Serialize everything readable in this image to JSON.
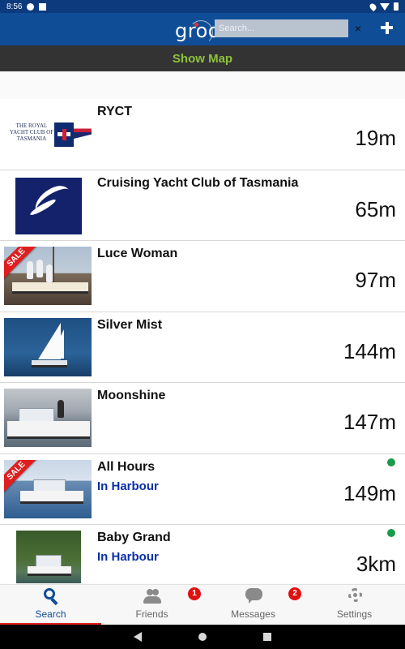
{
  "status_bar": {
    "time": "8:56"
  },
  "app_bar": {
    "logo_text": "groo",
    "search_placeholder": "Search...",
    "clear_label": "×"
  },
  "show_map_label": "Show Map",
  "listings": [
    {
      "title": "RYCT",
      "distance": "19m",
      "status": "",
      "online": false,
      "sale": false,
      "logo_text": "THE ROYAL YACHT CLUB OF TASMANIA"
    },
    {
      "title": "Cruising Yacht Club of Tasmania",
      "distance": "65m",
      "status": "",
      "online": false,
      "sale": false
    },
    {
      "title": "Luce Woman",
      "distance": "97m",
      "status": "",
      "online": false,
      "sale": true
    },
    {
      "title": "Silver Mist",
      "distance": "144m",
      "status": "",
      "online": false,
      "sale": false
    },
    {
      "title": "Moonshine",
      "distance": "147m",
      "status": "",
      "online": false,
      "sale": false
    },
    {
      "title": "All Hours",
      "distance": "149m",
      "status": "In Harbour",
      "online": true,
      "sale": true
    },
    {
      "title": "Baby Grand",
      "distance": "3km",
      "status": "In Harbour",
      "online": true,
      "sale": false
    }
  ],
  "sale_badge": "SALE",
  "tabs": [
    {
      "label": "Search",
      "badge": ""
    },
    {
      "label": "Friends",
      "badge": "1"
    },
    {
      "label": "Messages",
      "badge": "2"
    },
    {
      "label": "Settings",
      "badge": ""
    }
  ],
  "colors": {
    "app_bar": "#0f4d97",
    "status_bar": "#0c3a7d",
    "map_bar": "#333333",
    "map_bar_text": "#8fc23b",
    "status_text": "#0b2fa8",
    "online_dot": "#1a9a4c",
    "badge": "#e01010",
    "active_tab_indicator": "#e01e1e"
  }
}
